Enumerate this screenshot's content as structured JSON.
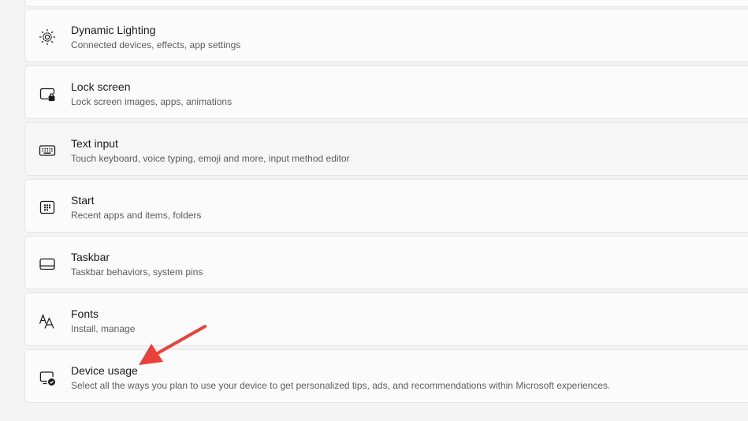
{
  "settings_items": [
    {
      "title": "Dynamic Lighting",
      "subtitle": "Connected devices, effects, app settings",
      "icon": "dynamic-lighting-icon"
    },
    {
      "title": "Lock screen",
      "subtitle": "Lock screen images, apps, animations",
      "icon": "lock-screen-icon"
    },
    {
      "title": "Text input",
      "subtitle": "Touch keyboard, voice typing, emoji and more, input method editor",
      "icon": "keyboard-icon"
    },
    {
      "title": "Start",
      "subtitle": "Recent apps and items, folders",
      "icon": "start-icon"
    },
    {
      "title": "Taskbar",
      "subtitle": "Taskbar behaviors, system pins",
      "icon": "taskbar-icon"
    },
    {
      "title": "Fonts",
      "subtitle": "Install, manage",
      "icon": "fonts-icon"
    },
    {
      "title": "Device usage",
      "subtitle": "Select all the ways you plan to use your device to get personalized tips, ads, and recommendations within Microsoft experiences.",
      "icon": "device-usage-icon"
    }
  ],
  "colors": {
    "background": "#f3f3f3",
    "card": "#fbfbfb",
    "card_hover": "#f6f6f6",
    "annotation_arrow": "#e8413b"
  }
}
